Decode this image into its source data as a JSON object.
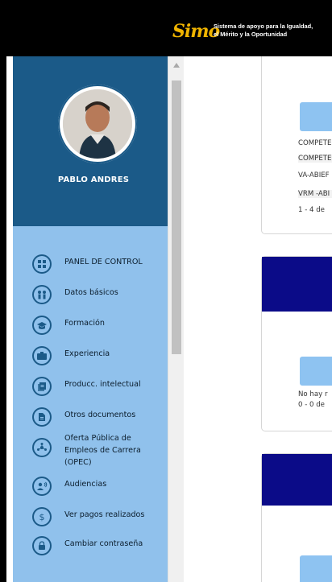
{
  "header": {
    "logo_text": "Simo",
    "tagline_line1": "Sistema de apoyo para la Igualdad,",
    "tagline_line2": "el Mérito y la Oportunidad"
  },
  "profile": {
    "name": "PABLO ANDRES"
  },
  "sidebar": {
    "items": [
      {
        "label": "PANEL DE CONTROL",
        "icon": "dashboard-icon"
      },
      {
        "label": "Datos básicos",
        "icon": "people-icon"
      },
      {
        "label": "Formación",
        "icon": "graduation-icon"
      },
      {
        "label": "Experiencia",
        "icon": "briefcase-icon"
      },
      {
        "label": "Producc. intelectual",
        "icon": "document-stack-icon"
      },
      {
        "label": "Otros documentos",
        "icon": "document-icon"
      },
      {
        "label_line1": "Oferta Pública de",
        "label_line2": "Empleos de Carrera (OPEC)",
        "icon": "hub-icon"
      },
      {
        "label": "Audiencias",
        "icon": "speaking-person-icon"
      },
      {
        "label": "Ver pagos realizados",
        "icon": "dollar-icon"
      },
      {
        "label": "Cambiar contraseña",
        "icon": "lock-icon"
      }
    ]
  },
  "main": {
    "card1": {
      "rows": [
        "COMPETE",
        "COMPETE",
        "VA-ABIEF",
        "VRM -ABI"
      ],
      "footer": "1 - 4 de"
    },
    "card2": {
      "text_line1": "No hay r",
      "text_line2": "0 - 0 de"
    }
  },
  "colors": {
    "sidebar_dark": "#1b5a88",
    "sidebar_light": "#90c1ec",
    "card_header": "#0b0b88",
    "button_light": "#8ec3f1"
  }
}
